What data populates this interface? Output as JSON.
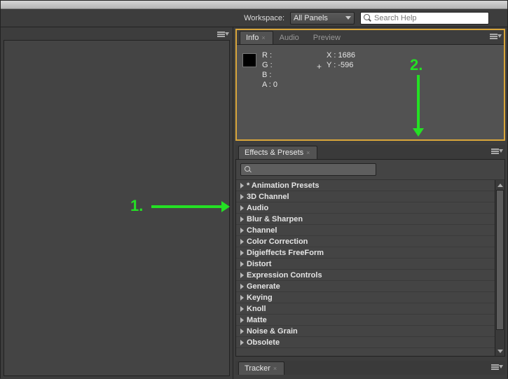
{
  "topbar": {
    "workspace_label": "Workspace:",
    "workspace_value": "All Panels",
    "search_placeholder": "Search Help"
  },
  "info_panel": {
    "tabs": [
      {
        "label": "Info",
        "active": true
      },
      {
        "label": "Audio",
        "active": false
      },
      {
        "label": "Preview",
        "active": false
      }
    ],
    "r_label": "R :",
    "g_label": "G :",
    "b_label": "B :",
    "a_label": "A : 0",
    "x_label": "X : 1686",
    "y_label": "Y : -596"
  },
  "effects_panel": {
    "title": "Effects & Presets",
    "items": [
      "* Animation Presets",
      "3D Channel",
      "Audio",
      "Blur & Sharpen",
      "Channel",
      "Color Correction",
      "Digieffects FreeForm",
      "Distort",
      "Expression Controls",
      "Generate",
      "Keying",
      "Knoll",
      "Matte",
      "Noise & Grain",
      "Obsolete"
    ]
  },
  "tracker_panel": {
    "title": "Tracker"
  },
  "annotations": {
    "one": "1.",
    "two": "2."
  }
}
